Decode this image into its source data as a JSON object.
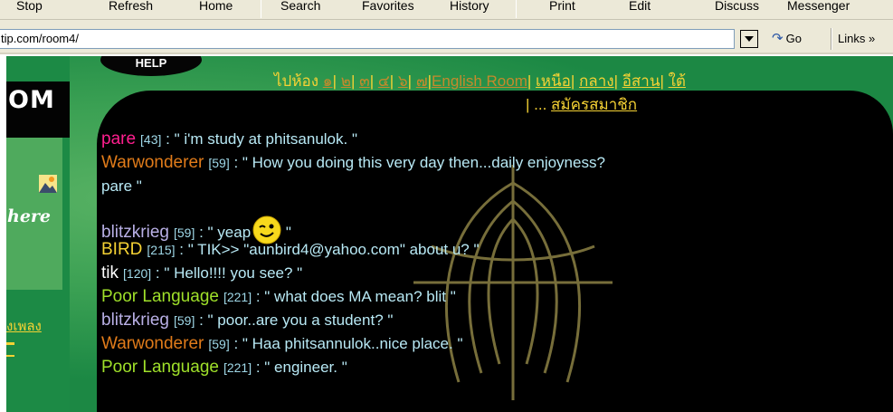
{
  "toolbar": {
    "buttons": [
      "Stop",
      "Refresh",
      "Home",
      "Search",
      "Favorites",
      "History",
      "Print",
      "Edit",
      "Discuss",
      "Messenger"
    ]
  },
  "address": {
    "url": "tip.com/room4/",
    "go_label": "Go",
    "links_label": "Links"
  },
  "sidebar": {
    "logo_text": "OM",
    "here_text": "here",
    "thai_link": "งเพลง"
  },
  "help_label": "HELP",
  "nav": {
    "goto_label": "ไปห้อง",
    "rooms": [
      "๑",
      "๒",
      "๓",
      "๔",
      "๖",
      "๗"
    ],
    "english_room": "English Room",
    "regions": [
      "เหนือ",
      "กลาง",
      "อีสาน",
      "ใต้"
    ],
    "ellipsis": "...",
    "register": "สมัครสมาชิก"
  },
  "chat": [
    {
      "user": "pare",
      "age": "[43]",
      "text": " : \" i'm study at phitsanulok.     \"",
      "color": "#ff1f8f"
    },
    {
      "user": "Warwonderer",
      "age": "[59]",
      "text": " : \" How you doing this very day then...daily enjoyness?",
      "color": "#e07b1a"
    },
    {
      "user": "",
      "age": "",
      "text": "pare      \"",
      "color": "#b8e9f5"
    },
    {
      "user": "blitzkrieg",
      "age": "[59]",
      "text": " : \" yeap",
      "color": "#b9b0e6",
      "smiley": true,
      "after": "      \""
    },
    {
      "user": "BIRD",
      "age": "[215]",
      "text": " : \" TIK>> \"aunbird4@yahoo.com\" about u?      \"",
      "color": "#f5d234"
    },
    {
      "user": "tik",
      "age": "[120]",
      "text": " : \" Hello!!!! you see?      \"",
      "color": "#ffffff"
    },
    {
      "user": "Poor Language",
      "age": "[221]",
      "text": " : \" what does MA mean? blit      \"",
      "color": "#9fe02a"
    },
    {
      "user": "blitzkrieg",
      "age": "[59]",
      "text": " : \" poor..are you a student?      \"",
      "color": "#b9b0e6"
    },
    {
      "user": "Warwonderer",
      "age": "[59]",
      "text": " : \" Haa phitsannulok..nice place.      \"",
      "color": "#e07b1a"
    },
    {
      "user": "Poor Language",
      "age": "[221]",
      "text": " : \" engineer.      \"",
      "color": "#9fe02a"
    }
  ],
  "colors": {
    "page_green": "#1c8a45",
    "chat_bg": "#000000",
    "nav_yellow": "#f5d234"
  }
}
